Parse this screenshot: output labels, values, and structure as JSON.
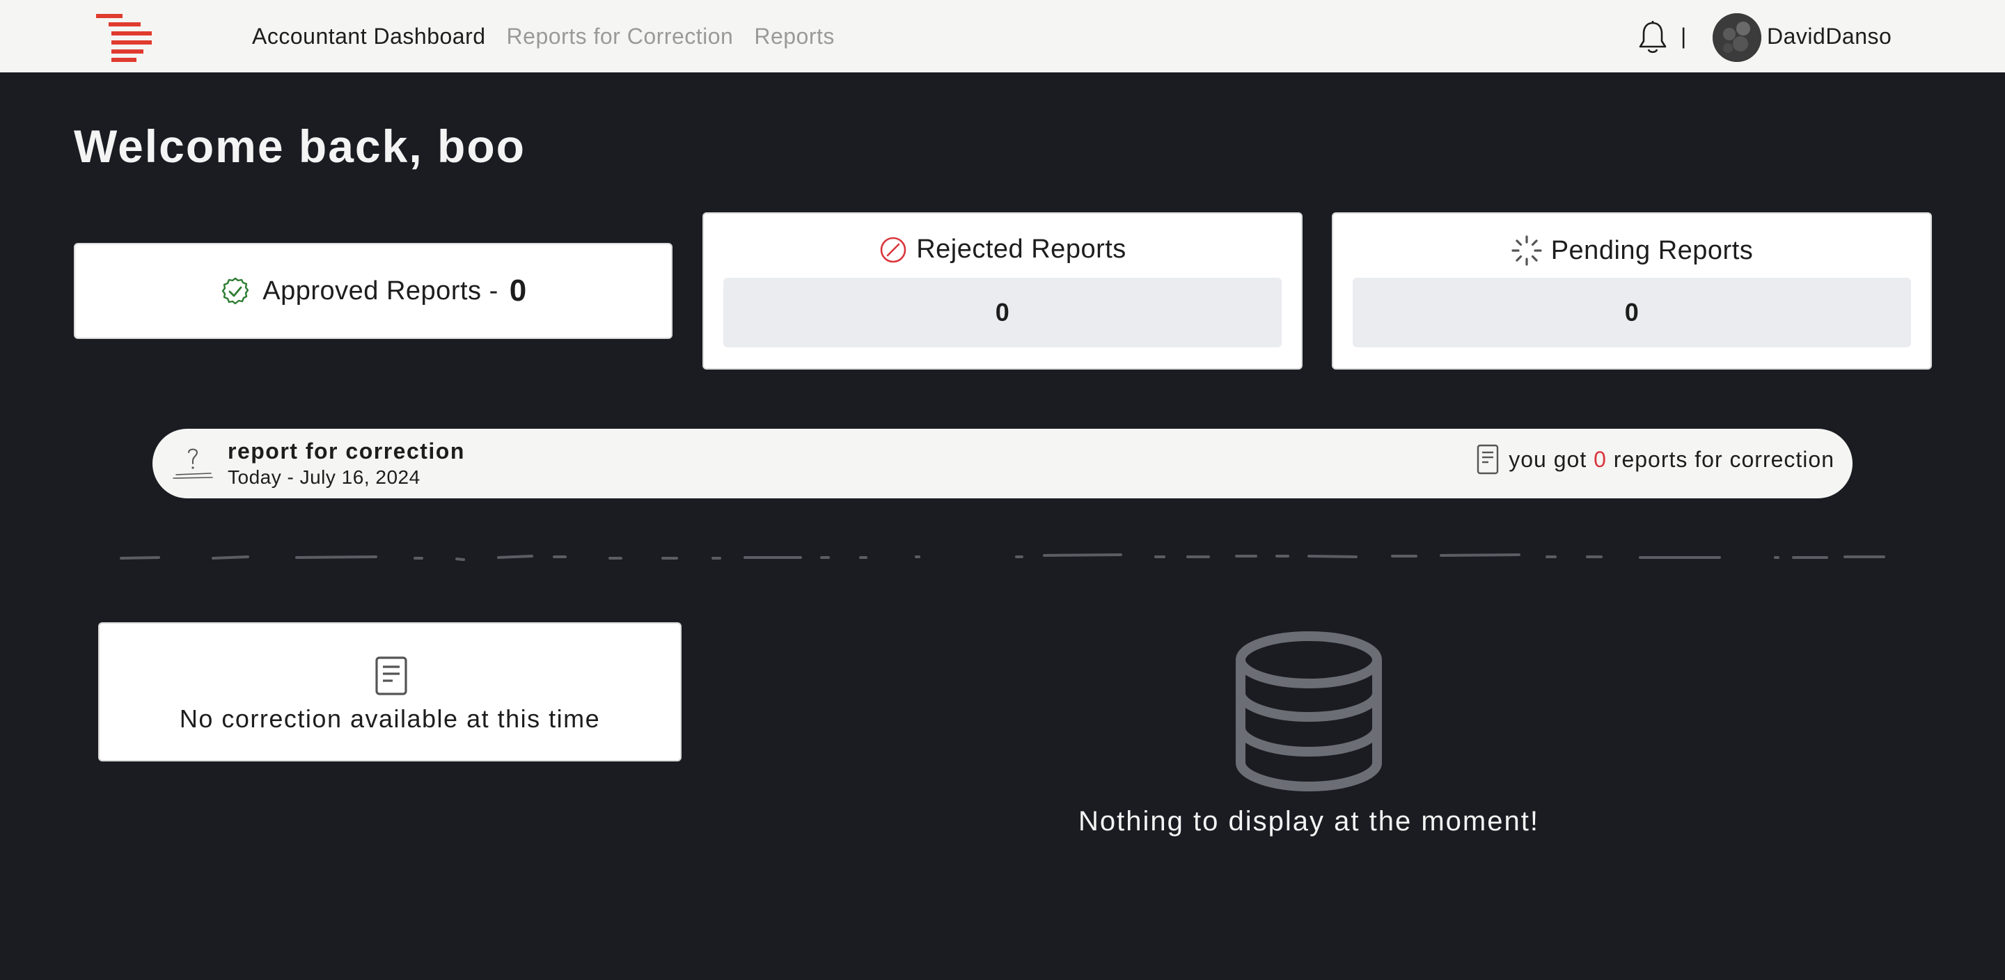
{
  "nav": {
    "links": [
      "Accountant Dashboard",
      "Reports for Correction",
      "Reports"
    ],
    "separator": "|",
    "username": "DavidDanso",
    "accent": "#e03b2f"
  },
  "welcome": {
    "title": "Welcome back, boo"
  },
  "stats": {
    "approved": {
      "label": "Approved Reports -",
      "value": "0",
      "color": "#2e7d32"
    },
    "rejected": {
      "label": "Rejected Reports",
      "value": "0",
      "color": "#d9363e"
    },
    "pending": {
      "label": "Pending Reports",
      "value": "0"
    }
  },
  "correction_bar": {
    "title": "report for correction",
    "date": "Today - July 16, 2024",
    "text_before": "you got",
    "count": "0",
    "text_after": "reports for correction"
  },
  "empty_states": {
    "corrections": "No correction available at this time",
    "main": "Nothing to display at the moment!"
  },
  "icons": [
    "logo-icon",
    "bell-icon",
    "avatar",
    "check-badge-icon",
    "rejected-icon",
    "spinner-icon",
    "question-icon",
    "document-icon",
    "database-icon"
  ]
}
